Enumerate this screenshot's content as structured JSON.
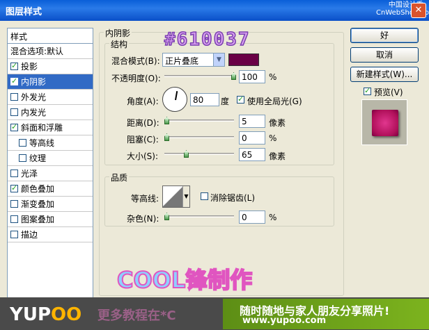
{
  "window": {
    "title": "图层样式",
    "close": "✕",
    "watermark": "中国设计秀\nCnWebShow.com"
  },
  "styles_panel": {
    "header": "样式",
    "items": [
      {
        "label": "混合选项:默认",
        "checkbox": false,
        "checked": false,
        "indent": false,
        "selected": false
      },
      {
        "label": "投影",
        "checkbox": true,
        "checked": true,
        "indent": false,
        "selected": false
      },
      {
        "label": "内阴影",
        "checkbox": true,
        "checked": true,
        "indent": false,
        "selected": true
      },
      {
        "label": "外发光",
        "checkbox": true,
        "checked": false,
        "indent": false,
        "selected": false
      },
      {
        "label": "内发光",
        "checkbox": true,
        "checked": false,
        "indent": false,
        "selected": false
      },
      {
        "label": "斜面和浮雕",
        "checkbox": true,
        "checked": true,
        "indent": false,
        "selected": false
      },
      {
        "label": "等高线",
        "checkbox": true,
        "checked": false,
        "indent": true,
        "selected": false
      },
      {
        "label": "纹理",
        "checkbox": true,
        "checked": false,
        "indent": true,
        "selected": false
      },
      {
        "label": "光泽",
        "checkbox": true,
        "checked": false,
        "indent": false,
        "selected": false
      },
      {
        "label": "颜色叠加",
        "checkbox": true,
        "checked": true,
        "indent": false,
        "selected": false
      },
      {
        "label": "渐变叠加",
        "checkbox": true,
        "checked": false,
        "indent": false,
        "selected": false
      },
      {
        "label": "图案叠加",
        "checkbox": true,
        "checked": false,
        "indent": false,
        "selected": false
      },
      {
        "label": "描边",
        "checkbox": true,
        "checked": false,
        "indent": false,
        "selected": false
      }
    ]
  },
  "inner_shadow": {
    "section_title": "内阴影",
    "structure": {
      "title": "结构",
      "blend_mode_label": "混合模式(B):",
      "blend_mode_value": "正片叠底",
      "shadow_color": "#6a0045",
      "opacity_label": "不透明度(O):",
      "opacity_value": "100",
      "opacity_unit": "%",
      "angle_label": "角度(A):",
      "angle_value": "80",
      "angle_unit": "度",
      "global_light_label": "使用全局光(G)",
      "global_light_checked": true,
      "distance_label": "距离(D):",
      "distance_value": "5",
      "distance_unit": "像素",
      "choke_label": "阻塞(C):",
      "choke_value": "0",
      "choke_unit": "%",
      "size_label": "大小(S):",
      "size_value": "65",
      "size_unit": "像素"
    },
    "quality": {
      "title": "品质",
      "contour_label": "等高线:",
      "anti_alias_label": "消除锯齿(L)",
      "anti_alias_checked": false,
      "noise_label": "杂色(N):",
      "noise_value": "0",
      "noise_unit": "%"
    }
  },
  "buttons": {
    "ok": "好",
    "cancel": "取消",
    "new_style": "新建样式(W)...",
    "preview_label": "预览(V)",
    "preview_checked": true
  },
  "decoration": {
    "overlay_top": "#610037",
    "overlay_bottom": "COOL锋制作"
  },
  "footer": {
    "logo_y": "Y",
    "logo_u": "U",
    "logo_p": "P",
    "logo_oo": "OO",
    "ad_left": "更多教程在*C",
    "ad_line1": "随时随地与家人朋友分享照片!",
    "ad_line2": "www.yupoo.com"
  }
}
